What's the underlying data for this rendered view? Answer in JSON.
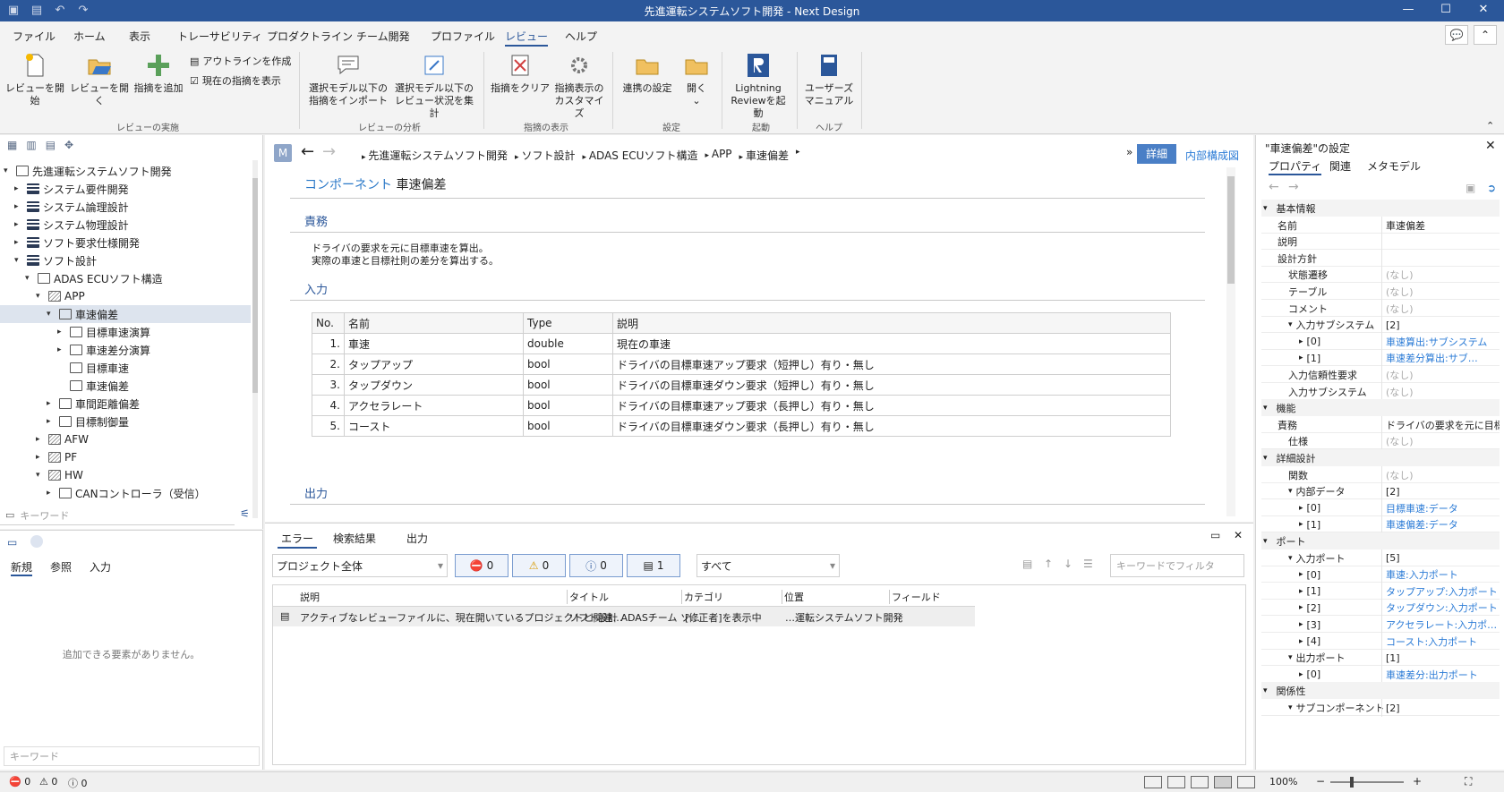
{
  "window": {
    "title": "先進運転システムソフト開発 - Next Design"
  },
  "menu": [
    "ファイル",
    "ホーム",
    "表示",
    "トレーサビリティ",
    "プロダクトライン",
    "チーム開発",
    "プロファイル",
    "レビュー",
    "ヘルプ"
  ],
  "ribbon": {
    "start_review": "レビューを開始",
    "open_review": "レビューを開く",
    "add_comment": "指摘を追加",
    "create_outline": "アウトラインを作成",
    "show_current": "現在の指摘を表示",
    "group_review": "レビューの実施",
    "import_selected_1": "選択モデル以下の",
    "import_selected_2": "指摘をインポート",
    "aggregate_1": "選択モデル以下の",
    "aggregate_2": "レビュー状況を集計",
    "group_analysis": "レビューの分析",
    "clear_comments": "指摘をクリア",
    "customize_1": "指摘表示の",
    "customize_2": "カスタマイズ",
    "group_display": "指摘の表示",
    "connection_settings": "連携の設定",
    "open": "開く",
    "group_settings": "設定",
    "lightning_1": "Lightning",
    "lightning_2": "Reviewを起動",
    "group_launch": "起動",
    "manual_1": "ユーザーズ",
    "manual_2": "マニュアル",
    "group_help": "ヘルプ"
  },
  "tree": {
    "root": "先進運転システムソフト開発",
    "items": [
      "システム要件開発",
      "システム論理設計",
      "システム物理設計",
      "ソフト要求仕様開発",
      "ソフト設計",
      "ADAS ECUソフト構造",
      "APP",
      "車速偏差",
      "目標車速演算",
      "車速差分演算",
      "目標車速",
      "車速偏差",
      "車間距離偏差",
      "目標制御量",
      "AFW",
      "PF",
      "HW",
      "CANコントローラ（受信）"
    ],
    "keyword_placeholder": "キーワード"
  },
  "bottom_left": {
    "tabs": [
      "新規",
      "参照",
      "入力"
    ],
    "empty": "追加できる要素がありません。",
    "keyword_placeholder": "キーワード"
  },
  "breadcrumb": {
    "badge": "M",
    "items": [
      "先進運転システムソフト開発",
      "ソフト設計",
      "ADAS ECUソフト構造",
      "APP",
      "車速偏差"
    ],
    "detail_btn": "詳細",
    "internal_link": "内部構成図"
  },
  "doc": {
    "type": "コンポーネント",
    "name": "車速偏差",
    "sec_duty": "責務",
    "duty_1": "ドライバの要求を元に目標車速を算出。",
    "duty_2": "実際の車速と目標社則の差分を算出する。",
    "sec_input": "入力",
    "sec_output": "出力",
    "table_headers": [
      "No.",
      "名前",
      "Type",
      "説明"
    ],
    "rows": [
      {
        "no": "1.",
        "name": "車速",
        "type": "double",
        "desc": "現在の車速"
      },
      {
        "no": "2.",
        "name": "タップアップ",
        "type": "bool",
        "desc": "ドライバの目標車速アップ要求（短押し）有り・無し"
      },
      {
        "no": "3.",
        "name": "タップダウン",
        "type": "bool",
        "desc": "ドライバの目標車速ダウン要求（短押し）有り・無し"
      },
      {
        "no": "4.",
        "name": "アクセラレート",
        "type": "bool",
        "desc": "ドライバの目標車速アップ要求（長押し）有り・無し"
      },
      {
        "no": "5.",
        "name": "コースト",
        "type": "bool",
        "desc": "ドライバの目標車速ダウン要求（長押し）有り・無し"
      }
    ]
  },
  "errors": {
    "tabs": [
      "エラー",
      "検索結果",
      "出力"
    ],
    "scope": "プロジェクト全体",
    "err_count": "0",
    "warn_count": "0",
    "info_count": "0",
    "msg_count": "1",
    "filter_all": "すべて",
    "filter_placeholder": "キーワードでフィルタ",
    "headers": [
      "説明",
      "タイトル",
      "カテゴリ",
      "位置",
      "フィールド"
    ],
    "row": {
      "desc": "アクティブなレビューファイルに、現在開いているプロジェクトと関連…",
      "title": "ソフト設計 ADASチーム ソ…",
      "category": "[修正者]を表示中",
      "location": "…運転システムソフト開発",
      "field": ""
    }
  },
  "props": {
    "title": "\"車速偏差\"の設定",
    "tabs": [
      "プロパティ",
      "関連",
      "メタモデル"
    ],
    "rows": [
      {
        "cat": true,
        "k": "基本情報"
      },
      {
        "k": "名前",
        "v": "車速偏差"
      },
      {
        "k": "説明",
        "v": ""
      },
      {
        "k": "設計方針",
        "v": ""
      },
      {
        "k": "状態遷移",
        "v": "(なし)",
        "muted": true,
        "ind": 1
      },
      {
        "k": "テーブル",
        "v": "(なし)",
        "muted": true,
        "ind": 1
      },
      {
        "k": "コメント",
        "v": "(なし)",
        "muted": true,
        "ind": 1
      },
      {
        "k": "入力サブシステム",
        "v": "[2]",
        "ind": 1,
        "exp": "open"
      },
      {
        "k": "[0]",
        "v": "車速算出:サブシステム",
        "link": true,
        "ind": 2,
        "exp": "closed"
      },
      {
        "k": "[1]",
        "v": "車速差分算出:サブ…",
        "link": true,
        "ind": 2,
        "exp": "closed"
      },
      {
        "k": "入力信頼性要求",
        "v": "(なし)",
        "muted": true,
        "ind": 1
      },
      {
        "k": "入力サブシステム",
        "v": "(なし)",
        "muted": true,
        "ind": 1
      },
      {
        "cat": true,
        "k": "機能"
      },
      {
        "k": "責務",
        "v": "ドライバの要求を元に目標…"
      },
      {
        "k": "仕様",
        "v": "(なし)",
        "muted": true,
        "ind": 1
      },
      {
        "cat": true,
        "k": "詳細設計"
      },
      {
        "k": "関数",
        "v": "(なし)",
        "muted": true,
        "ind": 1
      },
      {
        "k": "内部データ",
        "v": "[2]",
        "ind": 1,
        "exp": "open"
      },
      {
        "k": "[0]",
        "v": "目標車速:データ",
        "link": true,
        "ind": 2,
        "exp": "closed"
      },
      {
        "k": "[1]",
        "v": "車速偏差:データ",
        "link": true,
        "ind": 2,
        "exp": "closed"
      },
      {
        "cat": true,
        "k": "ポート"
      },
      {
        "k": "入力ポート",
        "v": "[5]",
        "ind": 1,
        "exp": "open"
      },
      {
        "k": "[0]",
        "v": "車速:入力ポート",
        "link": true,
        "ind": 2,
        "exp": "closed"
      },
      {
        "k": "[1]",
        "v": "タップアップ:入力ポート",
        "link": true,
        "ind": 2,
        "exp": "closed"
      },
      {
        "k": "[2]",
        "v": "タップダウン:入力ポート",
        "link": true,
        "ind": 2,
        "exp": "closed"
      },
      {
        "k": "[3]",
        "v": "アクセラレート:入力ポ…",
        "link": true,
        "ind": 2,
        "exp": "closed"
      },
      {
        "k": "[4]",
        "v": "コースト:入力ポート",
        "link": true,
        "ind": 2,
        "exp": "closed"
      },
      {
        "k": "出力ポート",
        "v": "[1]",
        "ind": 1,
        "exp": "open"
      },
      {
        "k": "[0]",
        "v": "車速差分:出力ポート",
        "link": true,
        "ind": 2,
        "exp": "closed"
      },
      {
        "cat": true,
        "k": "関係性"
      },
      {
        "k": "サブコンポーネント",
        "v": "[2]",
        "ind": 1,
        "exp": "open"
      }
    ]
  },
  "status": {
    "errors": "0",
    "warnings": "0",
    "infos": "0",
    "zoom": "100%"
  }
}
